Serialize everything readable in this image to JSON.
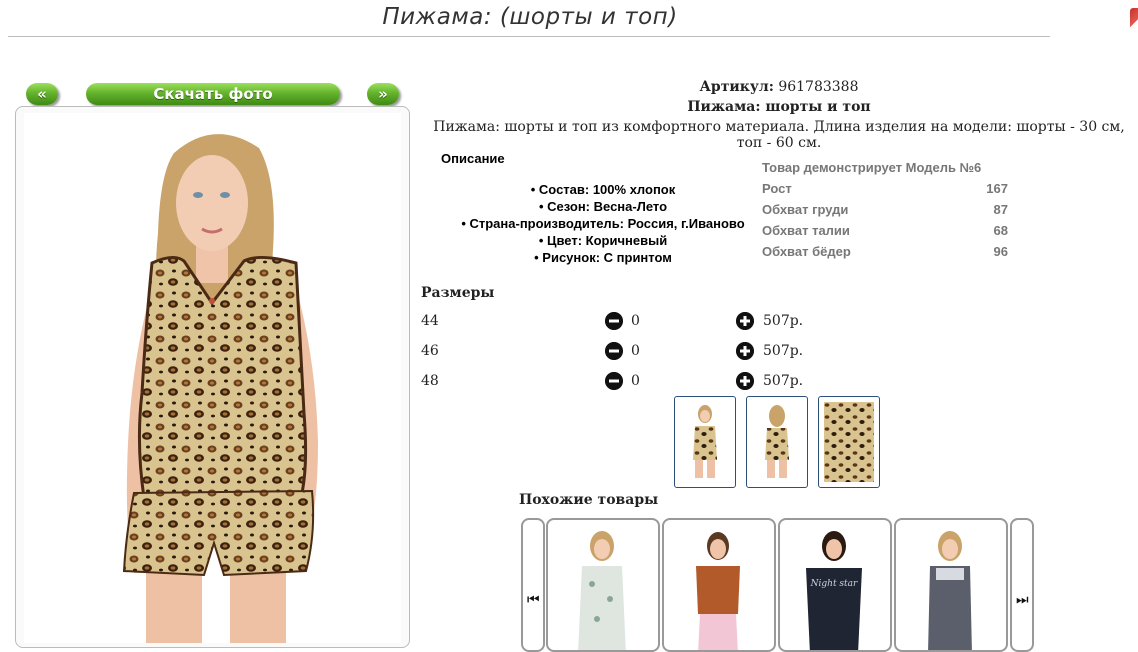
{
  "page": {
    "title": "Пижама: (шорты и топ)"
  },
  "gallery": {
    "prev_label": "«",
    "download_label": "Скачать фото",
    "next_label": "»"
  },
  "product": {
    "article_label": "Артикул:",
    "article_value": "961783388",
    "name": "Пижама: шорты и топ",
    "description": "Пижама: шорты и топ из комфортного материала. Длина изделия на модели: шорты - 30 см, топ - 60 см."
  },
  "details": {
    "heading": "Описание",
    "bullets": [
      "• Состав: 100% хлопок",
      "• Сезон: Весна-Лето",
      "• Страна-производитель: Россия, г.Иваново",
      "• Цвет: Коричневый",
      "• Рисунок: С принтом"
    ]
  },
  "model": {
    "heading": "Товар демонстрирует Модель №6",
    "rows": [
      {
        "label": "Рост",
        "value": "167"
      },
      {
        "label": "Обхват груди",
        "value": "87"
      },
      {
        "label": "Обхват талии",
        "value": "68"
      },
      {
        "label": "Обхват бёдер",
        "value": "96"
      }
    ]
  },
  "sizes": {
    "heading": "Размеры",
    "rows": [
      {
        "size": "44",
        "qty": "0",
        "price": "507р."
      },
      {
        "size": "46",
        "qty": "0",
        "price": "507р."
      },
      {
        "size": "48",
        "qty": "0",
        "price": "507р."
      }
    ],
    "minus_icon": "minus-circle-icon",
    "plus_icon": "plus-circle-icon"
  },
  "similar": {
    "heading": "Похожие товары",
    "prev_icon": "skip-previous-icon",
    "next_icon": "skip-next-icon",
    "prev_glyph": "⏮",
    "next_glyph": "⏭"
  },
  "colors": {
    "button_green": "#5aa624",
    "thumb_border": "#2c4f7a",
    "leopard_base": "#d6bf8a",
    "muted_text": "#777777"
  }
}
